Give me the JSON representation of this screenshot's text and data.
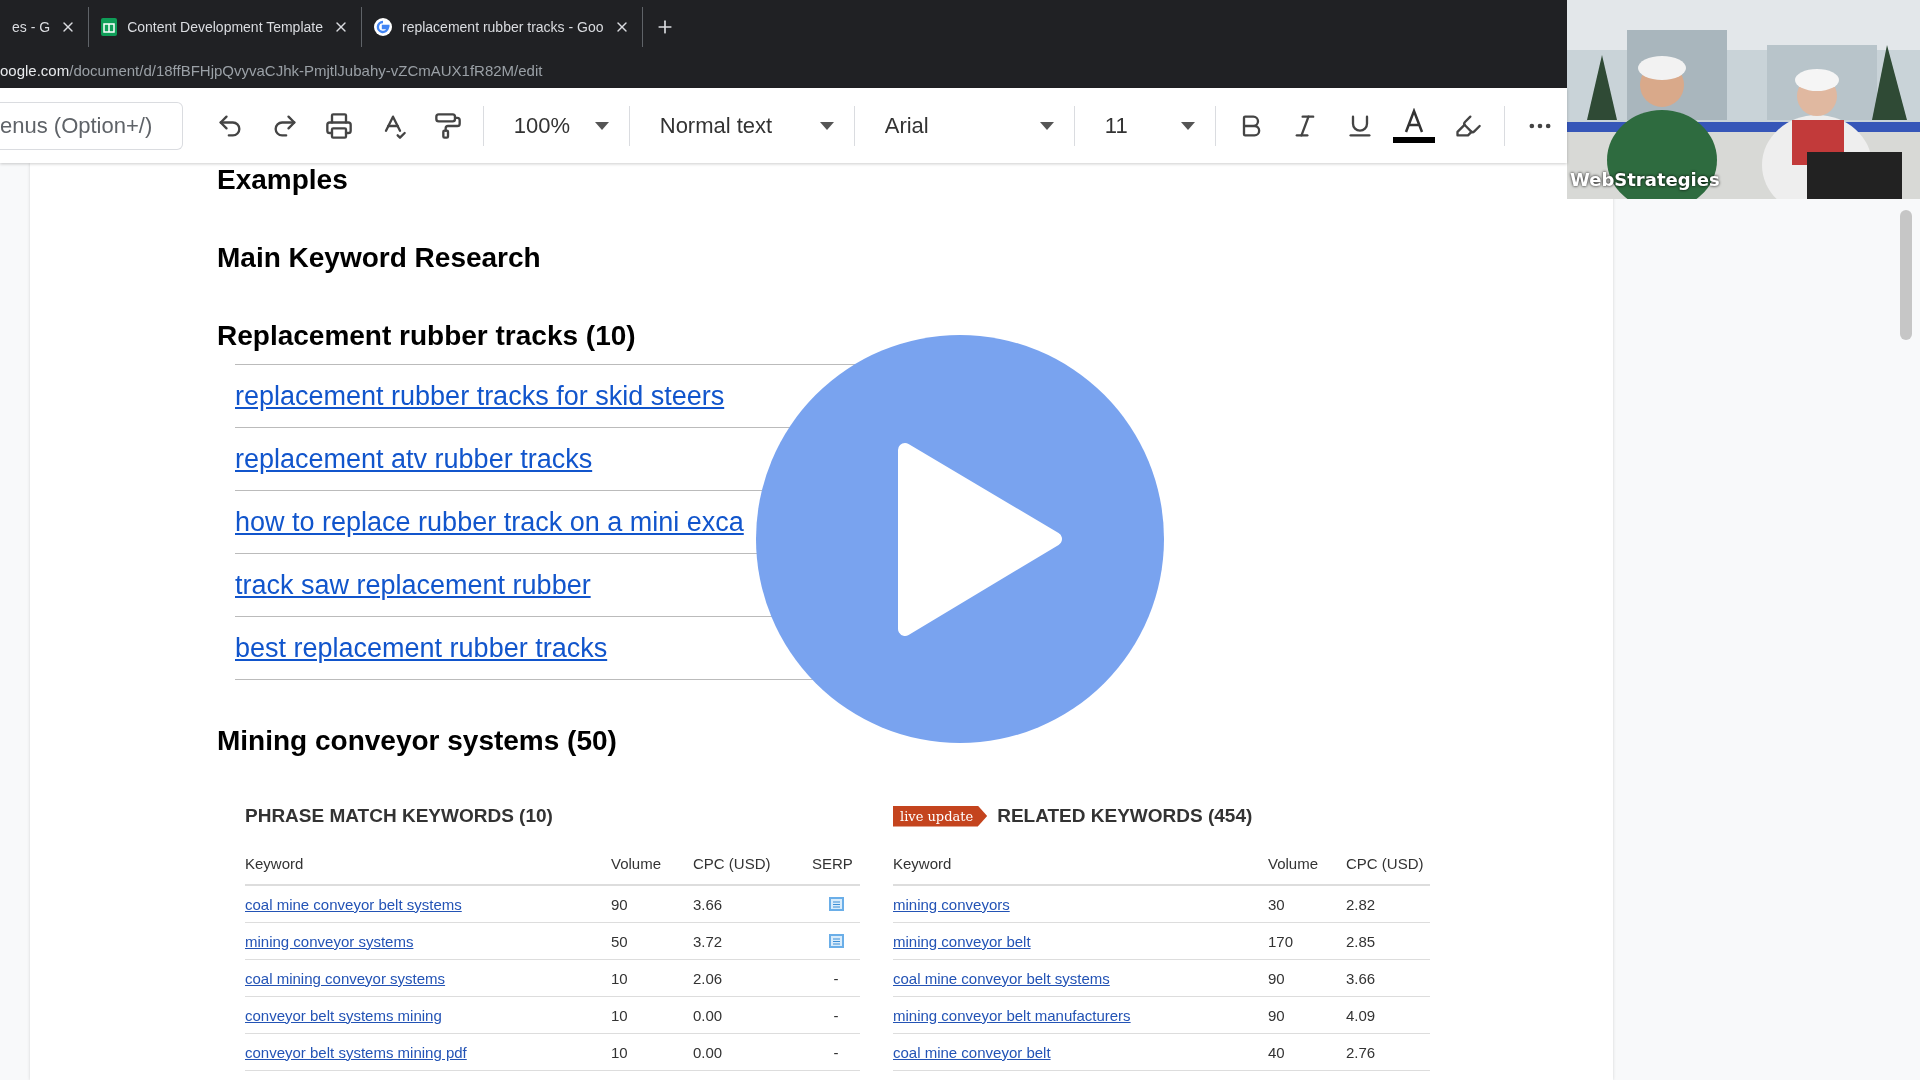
{
  "browser": {
    "tabs": [
      {
        "title": "es - G"
      },
      {
        "title": "Content Development Template"
      },
      {
        "title": "replacement rubber tracks - Goo"
      }
    ],
    "url_host": "oogle.com",
    "url_path": "/document/d/18ffBFHjpQvyvaCJhk-PmjtlJubahy-vZCmAUX1fR82M/edit"
  },
  "toolbar": {
    "menu_search": {
      "placeholder": "enus (Option+/)"
    },
    "zoom": "100%",
    "style": "Normal text",
    "font": "Arial",
    "size": "11"
  },
  "webcam": {
    "label": "WebStrategies"
  },
  "document": {
    "blocks": [
      {
        "kind": "heading",
        "text": "Examples"
      },
      {
        "kind": "heading",
        "text": "Main Keyword Research"
      },
      {
        "kind": "heading",
        "text": "Replacement rubber tracks (10)"
      },
      {
        "kind": "links",
        "items": [
          "replacement rubber tracks for skid steers",
          "replacement atv rubber tracks",
          "how to replace rubber track on a mini exca",
          "track saw replacement rubber",
          "best replacement rubber tracks"
        ]
      },
      {
        "kind": "heading",
        "text": "Mining conveyor systems (50)"
      }
    ],
    "tables": [
      {
        "title": "PHRASE MATCH KEYWORDS (10)",
        "columns": [
          "Keyword",
          "Volume",
          "CPC (USD)",
          "SERP"
        ],
        "rows": [
          {
            "cells": [
              "coal mine conveyor belt systems",
              "90",
              "3.66"
            ],
            "serp": {
              "kind": "icon"
            }
          },
          {
            "cells": [
              "mining conveyor systems",
              "50",
              "3.72"
            ],
            "serp": {
              "kind": "icon"
            }
          },
          {
            "cells": [
              "coal mining conveyor systems",
              "10",
              "2.06"
            ],
            "serp": {
              "kind": "text",
              "text": "-"
            }
          },
          {
            "cells": [
              "conveyor belt systems mining",
              "10",
              "0.00"
            ],
            "serp": {
              "kind": "text",
              "text": "-"
            }
          },
          {
            "cells": [
              "conveyor belt systems mining pdf",
              "10",
              "0.00"
            ],
            "serp": {
              "kind": "text",
              "text": "-"
            }
          }
        ]
      },
      {
        "title": "RELATED KEYWORDS (454)",
        "badge": "live update",
        "columns": [
          "Keyword",
          "Volume",
          "CPC (USD)"
        ],
        "rows": [
          {
            "cells": [
              "mining conveyors",
              "30",
              "2.82"
            ]
          },
          {
            "cells": [
              "mining conveyor belt",
              "170",
              "2.85"
            ]
          },
          {
            "cells": [
              "coal mine conveyor belt systems",
              "90",
              "3.66"
            ]
          },
          {
            "cells": [
              "mining conveyor belt manufacturers",
              "90",
              "4.09"
            ]
          },
          {
            "cells": [
              "coal mine conveyor belt",
              "40",
              "2.76"
            ]
          }
        ]
      }
    ]
  }
}
